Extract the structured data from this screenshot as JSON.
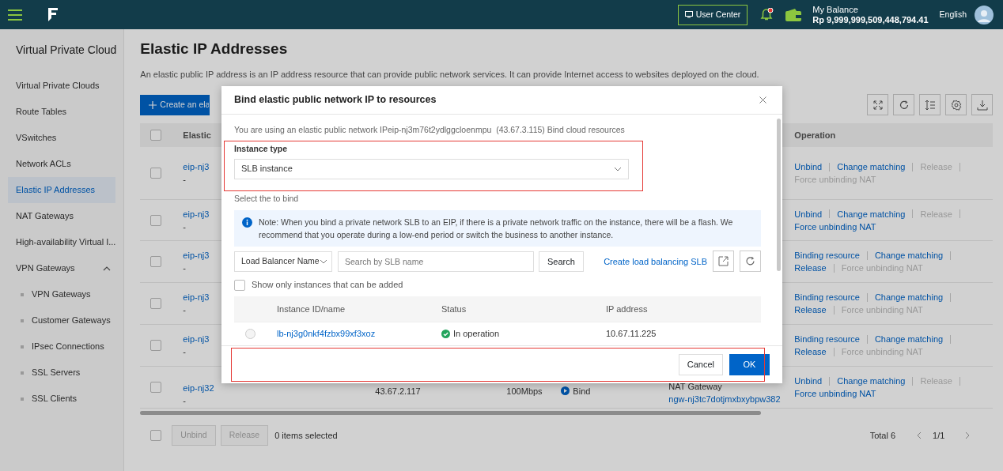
{
  "top_bar": {
    "user_center": "User Center",
    "notification_unread": true,
    "balance_label": "My Balance",
    "balance": "Rp 9,999,999,509,448,794.41",
    "language": "English"
  },
  "sidebar": {
    "title": "Virtual Private Cloud",
    "items": [
      {
        "label": "Virtual Private Clouds",
        "selected": false
      },
      {
        "label": "Route Tables",
        "selected": false
      },
      {
        "label": "VSwitches",
        "selected": false
      },
      {
        "label": "Network ACLs",
        "selected": false
      },
      {
        "label": "Elastic IP Addresses",
        "selected": true
      },
      {
        "label": "NAT Gateways",
        "selected": false
      },
      {
        "label": "High-availability Virtual I...",
        "selected": false
      },
      {
        "label": "VPN Gateways",
        "selected": false,
        "expanded": true,
        "children": [
          {
            "label": "VPN Gateways",
            "selected": false
          },
          {
            "label": "Customer Gateways",
            "selected": false
          },
          {
            "label": "IPsec Connections",
            "selected": false
          },
          {
            "label": "SSL Servers",
            "selected": false
          },
          {
            "label": "SSL Clients",
            "selected": false
          }
        ]
      }
    ]
  },
  "page": {
    "title": "Elastic IP Addresses",
    "description": "An elastic public IP address is an IP address resource that can provide public network services. It can provide Internet access to websites deployed on the cloud.",
    "create_button": "Create an ela",
    "table": {
      "select_all": false,
      "columns": [
        "Elastic",
        "Operation"
      ],
      "rows": [
        {
          "id": "eip-nj3",
          "name": "-",
          "checked": false,
          "actions": [
            {
              "label": "Unbind",
              "disabled": false
            },
            {
              "label": "Change matching",
              "disabled": false
            },
            {
              "label": "Release",
              "disabled": true
            },
            {
              "label": "Force unbinding NAT",
              "disabled": true
            }
          ]
        },
        {
          "id": "eip-nj3",
          "name": "-",
          "checked": false,
          "actions": [
            {
              "label": "Unbind",
              "disabled": false
            },
            {
              "label": "Change matching",
              "disabled": false
            },
            {
              "label": "Release",
              "disabled": true
            },
            {
              "label": "Force unbinding NAT",
              "disabled": false
            }
          ]
        },
        {
          "id": "eip-nj3",
          "name": "-",
          "checked": false,
          "actions": [
            {
              "label": "Binding resource",
              "disabled": false
            },
            {
              "label": "Change matching",
              "disabled": false
            },
            {
              "label": "Release",
              "disabled": false
            },
            {
              "label": "Force unbinding NAT",
              "disabled": true
            }
          ]
        },
        {
          "id": "eip-nj3",
          "name": "-",
          "checked": false,
          "actions": [
            {
              "label": "Binding resource",
              "disabled": false
            },
            {
              "label": "Change matching",
              "disabled": false
            },
            {
              "label": "Release",
              "disabled": false
            },
            {
              "label": "Force unbinding NAT",
              "disabled": true
            }
          ]
        },
        {
          "id": "eip-nj3",
          "name": "-",
          "checked": false,
          "actions": [
            {
              "label": "Binding resource",
              "disabled": false
            },
            {
              "label": "Change matching",
              "disabled": false
            },
            {
              "label": "Release",
              "disabled": false
            },
            {
              "label": "Force unbinding NAT",
              "disabled": true
            }
          ]
        },
        {
          "id": "eip-nj32",
          "name": "-",
          "checked": false,
          "ip": "43.67.2.117",
          "bandwidth": "100Mbps",
          "status": "Bind",
          "instance_type": "NAT Gateway",
          "instance": "ngw-nj3tc7dotjmxbxybpw382",
          "actions": [
            {
              "label": "Unbind",
              "disabled": false
            },
            {
              "label": "Change matching",
              "disabled": false
            },
            {
              "label": "Release",
              "disabled": true
            },
            {
              "label": "Force unbinding NAT",
              "disabled": false
            }
          ]
        }
      ]
    },
    "footer": {
      "select_all": false,
      "unbind": {
        "label": "Unbind",
        "disabled": true
      },
      "release": {
        "label": "Release",
        "disabled": true
      },
      "selected_count": "0 items selected",
      "total": "Total 6",
      "page": "1/1"
    }
  },
  "dialog": {
    "title": "Bind elastic public network IP to resources",
    "intro": "You are using an elastic public network IPeip-nj3m76t2ydlggcloenmpu  (43.67.3.115) Bind cloud resources",
    "instance_type_label": "Instance type",
    "instance_type": "SLB instance",
    "select_label": "Select the to bind",
    "note": "Note: When you bind a private network SLB to an EIP, if there is a private network traffic on the instance, there will be a flash. We recommend that you operate during a low-end period or switch the business to another instance.",
    "filter": "Load Balancer Name",
    "search_placeholder": "Search by SLB name",
    "search_button": "Search",
    "create_link": "Create load balancing SLB",
    "show_only": {
      "label": "Show only instances that can be added",
      "checked": false
    },
    "columns": [
      "Instance ID/name",
      "Status",
      "IP address"
    ],
    "rows": [
      {
        "id": "lb-nj3g0nkf4fzbx99xf3xoz",
        "status": "In operation",
        "ip": "10.67.11.225",
        "selected": false
      }
    ],
    "cancel": "Cancel",
    "ok": "OK"
  }
}
